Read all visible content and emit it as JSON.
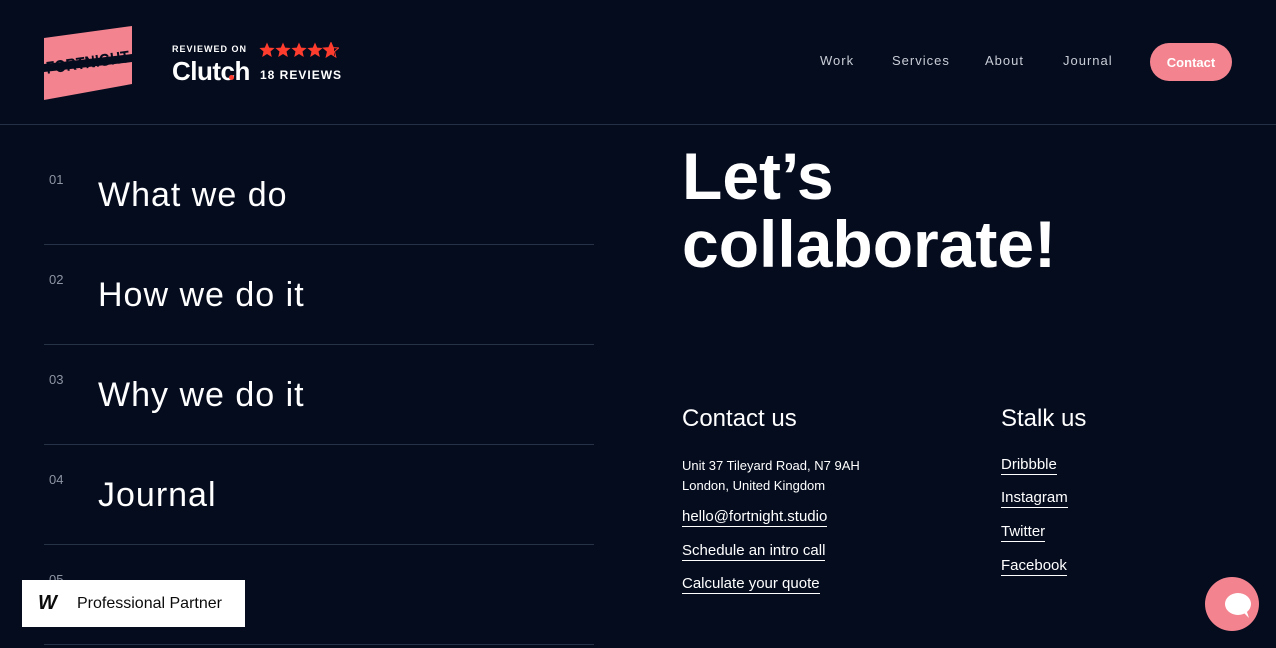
{
  "header": {
    "logo_text": "FORTNIGHT",
    "clutch": {
      "reviewed_label": "REVIEWED ON",
      "brand": "Clutch",
      "reviews": "18 REVIEWS",
      "rating": 4.8
    },
    "nav": [
      {
        "label": "Work"
      },
      {
        "label": "Services"
      },
      {
        "label": "About"
      },
      {
        "label": "Journal"
      }
    ],
    "contact_label": "Contact"
  },
  "menu": [
    {
      "num": "01",
      "label": "What we do"
    },
    {
      "num": "02",
      "label": "How we do it"
    },
    {
      "num": "03",
      "label": "Why we do it"
    },
    {
      "num": "04",
      "label": "Journal"
    },
    {
      "num": "05",
      "label": ""
    }
  ],
  "hero": {
    "line1": "Let’s",
    "line2": "collaborate!"
  },
  "contact": {
    "title": "Contact us",
    "address_line1": "Unit 37 Tileyard Road, N7 9AH",
    "address_line2": "London, United Kingdom",
    "links": [
      {
        "label": "hello@fortnight.studio"
      },
      {
        "label": "Schedule an intro call"
      },
      {
        "label": "Calculate your quote"
      }
    ]
  },
  "social": {
    "title": "Stalk us",
    "links": [
      {
        "label": "Dribbble"
      },
      {
        "label": "Instagram"
      },
      {
        "label": "Twitter"
      },
      {
        "label": "Facebook"
      }
    ]
  },
  "badge": {
    "mark": "W",
    "label": "Professional Partner"
  },
  "colors": {
    "background": "#050c1e",
    "accent": "#f2838f",
    "star": "#ff3d2e"
  },
  "icons": {
    "chat": "chat-bubble-icon",
    "stars": "star-icon"
  }
}
